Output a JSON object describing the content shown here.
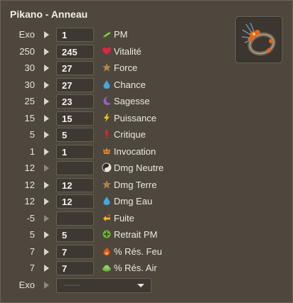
{
  "title": "Pikano - Anneau",
  "rows": [
    {
      "base": "Exo",
      "value": "1",
      "label": "PM",
      "icon": "pm-icon"
    },
    {
      "base": "250",
      "value": "245",
      "label": "Vitalité",
      "icon": "heart-icon"
    },
    {
      "base": "30",
      "value": "27",
      "label": "Force",
      "icon": "earth-icon"
    },
    {
      "base": "30",
      "value": "27",
      "label": "Chance",
      "icon": "water-drop-icon"
    },
    {
      "base": "25",
      "value": "23",
      "label": "Sagesse",
      "icon": "moon-icon"
    },
    {
      "base": "15",
      "value": "15",
      "label": "Puissance",
      "icon": "lightning-icon"
    },
    {
      "base": "5",
      "value": "5",
      "label": "Critique",
      "icon": "exclamation-icon"
    },
    {
      "base": "1",
      "value": "1",
      "label": "Invocation",
      "icon": "invocation-icon"
    },
    {
      "base": "12",
      "value": "",
      "label": "Dmg Neutre",
      "icon": "neutral-icon"
    },
    {
      "base": "12",
      "value": "12",
      "label": "Dmg Terre",
      "icon": "earth-icon"
    },
    {
      "base": "12",
      "value": "12",
      "label": "Dmg Eau",
      "icon": "water-drop-icon"
    },
    {
      "base": "-5",
      "value": "",
      "label": "Fuite",
      "icon": "flee-icon"
    },
    {
      "base": "5",
      "value": "5",
      "label": "Retrait PM",
      "icon": "pm-removal-icon"
    },
    {
      "base": "7",
      "value": "7",
      "label": "% Rés. Feu",
      "icon": "fire-icon"
    },
    {
      "base": "7",
      "value": "7",
      "label": "% Rés. Air",
      "icon": "air-icon"
    }
  ],
  "exo_select": {
    "base": "Exo",
    "placeholder": "------"
  }
}
